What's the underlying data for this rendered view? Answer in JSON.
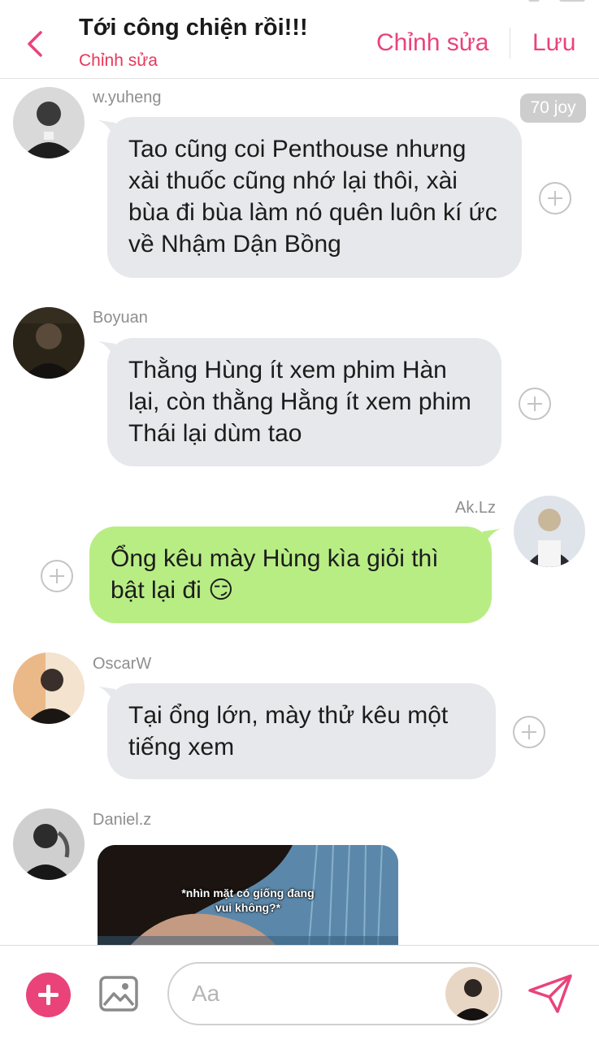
{
  "header": {
    "title": "Tới công chiện rồi!!!",
    "subtitle": "Chỉnh sửa",
    "edit_label": "Chỉnh sửa",
    "save_label": "Lưu"
  },
  "messages": [
    {
      "sender": "w.yuheng",
      "text": "Tao cũng coi Penthouse nhưng xài thuốc cũng nhớ lại thôi, xài bùa đi bùa làm nó quên luôn kí ức về Nhậm Dận Bồng",
      "badge": "70 joy",
      "direction": "incoming"
    },
    {
      "sender": "Boyuan",
      "text": "Thằng Hùng ít xem phim Hàn lại, còn thằng Hằng ít xem phim Thái lại dùm tao",
      "direction": "incoming"
    },
    {
      "sender": "Ak.Lz",
      "text": "Ổng kêu mày Hùng kìa giỏi thì bật lại đi 😏",
      "direction": "outgoing"
    },
    {
      "sender": "OscarW",
      "text": "Tại ổng lớn, mày thử kêu một tiếng xem",
      "direction": "incoming"
    },
    {
      "sender": "Daniel.z",
      "image_caption_line1": "*nhìn mặt có giống đang",
      "image_caption_line2": "vui không?*",
      "direction": "incoming"
    }
  ],
  "composer": {
    "placeholder": "Aa"
  },
  "colors": {
    "accent": "#e9437a",
    "subtitle": "#e8375a",
    "incoming_bubble": "#e6e8eb",
    "outgoing_bubble": "#b8ed84",
    "username": "#8e8e8e"
  },
  "icons": {
    "back": "chevron-left-icon",
    "add_reaction": "plus-circle-icon",
    "composer_plus": "plus-icon",
    "gallery": "image-icon",
    "send": "send-icon"
  }
}
